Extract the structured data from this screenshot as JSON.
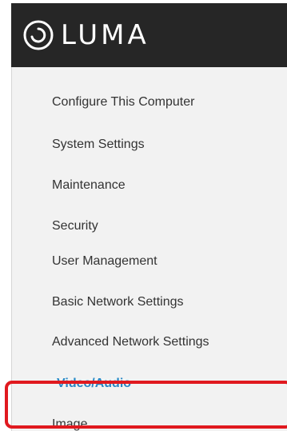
{
  "logo": {
    "text": "LUMA",
    "icon": "luma-logo-icon"
  },
  "sidebar": {
    "items": [
      {
        "label": "Configure This Computer",
        "active": false
      },
      {
        "label": "System Settings",
        "active": false
      },
      {
        "label": "Maintenance",
        "active": false
      },
      {
        "label": "Security",
        "active": false
      },
      {
        "label": "User Management",
        "active": false
      },
      {
        "label": "Basic Network Settings",
        "active": false
      },
      {
        "label": "Advanced Network Settings",
        "active": false
      },
      {
        "label": "Video/Audio",
        "active": true
      },
      {
        "label": "Image",
        "active": false
      }
    ]
  },
  "colors": {
    "header": "#262626",
    "panel": "#f2f2f2",
    "active_text": "#2a86c4",
    "highlight": "#e0191f"
  }
}
